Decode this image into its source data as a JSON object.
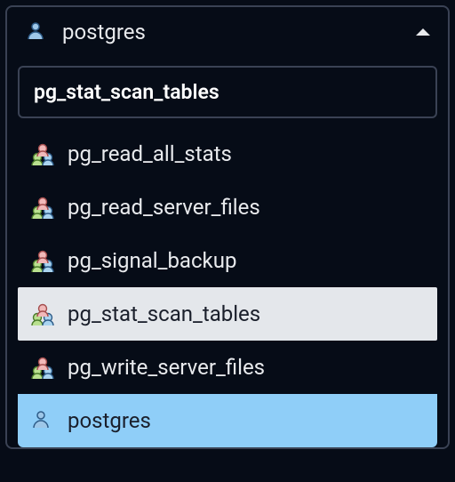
{
  "select": {
    "current": "postgres",
    "search_value": "pg_stat_scan_tables",
    "options": [
      {
        "label": "pg_read_all_stats",
        "icon": "group",
        "state": ""
      },
      {
        "label": "pg_read_server_files",
        "icon": "group",
        "state": ""
      },
      {
        "label": "pg_signal_backup",
        "icon": "group",
        "state": ""
      },
      {
        "label": "pg_stat_scan_tables",
        "icon": "group",
        "state": "highlight"
      },
      {
        "label": "pg_write_server_files",
        "icon": "group",
        "state": ""
      },
      {
        "label": "postgres",
        "icon": "user",
        "state": "selected"
      }
    ]
  }
}
